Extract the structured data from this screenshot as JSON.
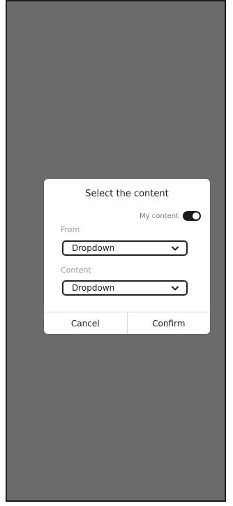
{
  "dialog": {
    "title": "Select the content",
    "toggle": {
      "label": "My content",
      "state": "on"
    },
    "from": {
      "label": "From",
      "value": "Dropdown"
    },
    "content": {
      "label": "Content",
      "value": "Dropdown"
    },
    "cancel_label": "Cancel",
    "confirm_label": "Confirm"
  },
  "colors": {
    "overlay": "#6b6b6b",
    "dialog_bg": "#ffffff",
    "toggle_on": "#1a1a1a",
    "divider": "#d8d8d8",
    "muted_text": "#9a9a9a"
  },
  "icons": {
    "dropdown": "chevron-down-icon"
  }
}
